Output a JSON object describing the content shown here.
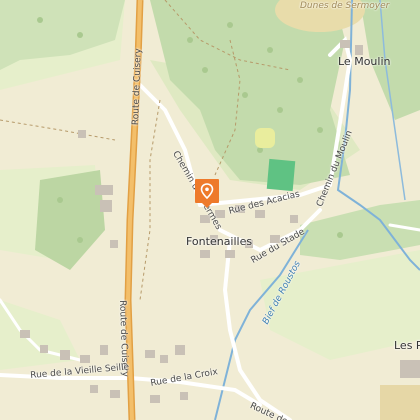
{
  "colors": {
    "background": "#f1ecd4",
    "forest": "#c6ddb0",
    "forest_dark": "#b7d29f",
    "field": "#e4ecc7",
    "water": "#7fb2d8",
    "main_road": "#e9a94a",
    "pin": "#ee7a2b"
  },
  "labels": {
    "dunes": "Dunes de Sermoyer",
    "le_moulin": "Le Moulin",
    "route_cuisery_top": "Route de Cuisery",
    "route_cuisery_bottom": "Route de Cuisery",
    "chemin_fermes": "Chemin des Fermes",
    "rue_acacias": "Rue des Acacias",
    "chemin_moulin": "Chemin du Moulin",
    "fontenailles": "Fontenailles",
    "rue_stade": "Rue du Stade",
    "bief_roustos": "Bief de Roustos",
    "rue_vieille_seille": "Rue de la Vieille Seille",
    "rue_croix": "Rue de la Croix",
    "route_de": "Route de",
    "les_p": "Les P"
  },
  "marker": {
    "icon": "location-pin-icon"
  }
}
